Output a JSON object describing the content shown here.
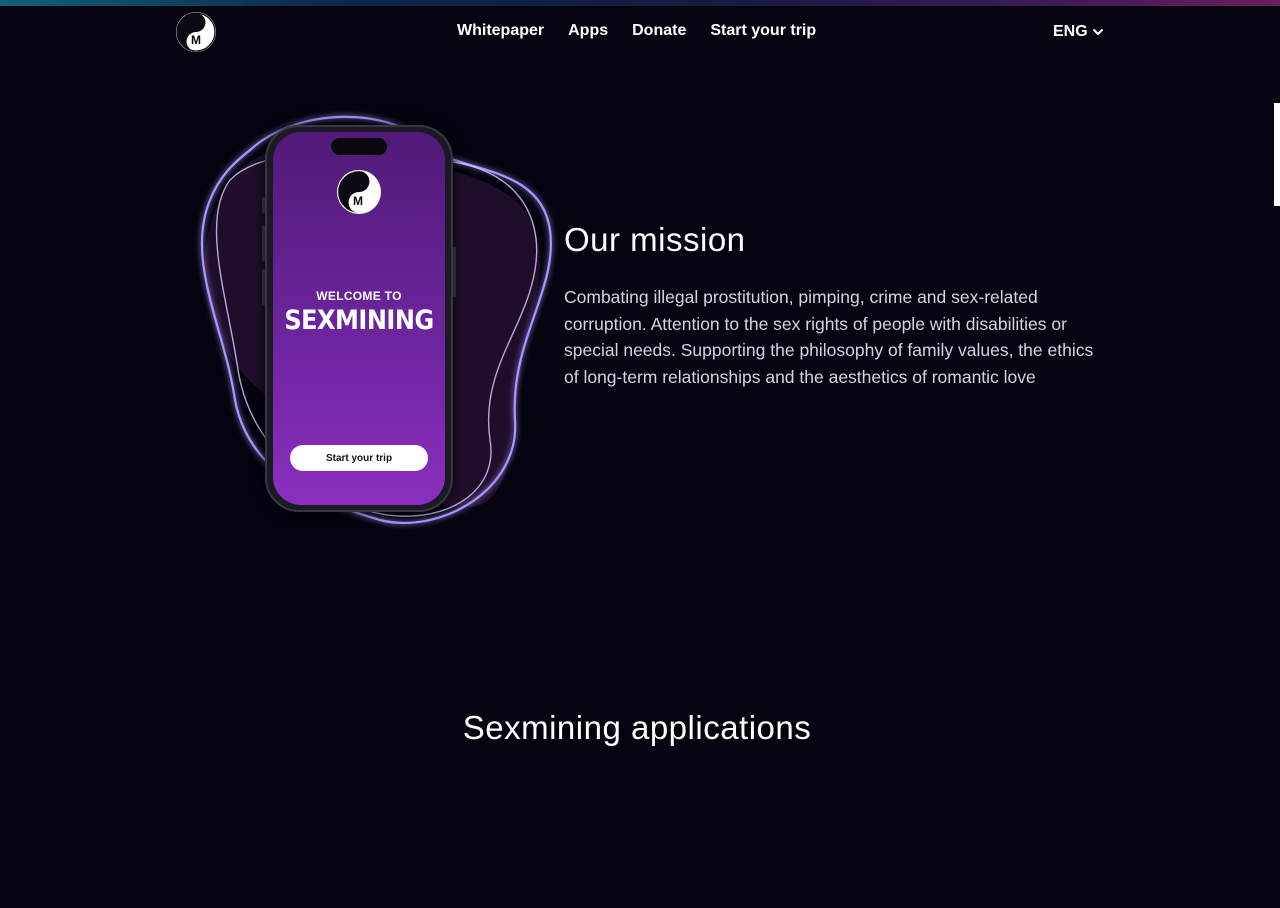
{
  "header": {
    "logo": {
      "top_letter": "S",
      "bottom_letter": "M"
    },
    "nav": [
      {
        "label": "Whitepaper"
      },
      {
        "label": "Apps"
      },
      {
        "label": "Donate"
      },
      {
        "label": "Start your trip"
      }
    ],
    "language": {
      "label": "ENG",
      "icon": "chevron-down-icon"
    }
  },
  "hero": {
    "phone": {
      "logo": {
        "top_letter": "S",
        "bottom_letter": "M"
      },
      "welcome": "WELCOME TO",
      "brand": "SEXMINING",
      "button": "Start your trip"
    }
  },
  "mission": {
    "title": "Our mission",
    "text": "Combating illegal prostitution, pimping, crime and sex-related corruption. Attention to the sex rights of people with disabilities or special needs. Supporting the philosophy of family values, the ethics of long-term relationships and the aesthetics of romantic love"
  },
  "applications": {
    "title": "Sexmining applications"
  },
  "colors": {
    "background": "#04030f",
    "accent_purple": "#7a28ad",
    "glow": "#8f7bff",
    "text_muted": "#d7d3e2"
  }
}
